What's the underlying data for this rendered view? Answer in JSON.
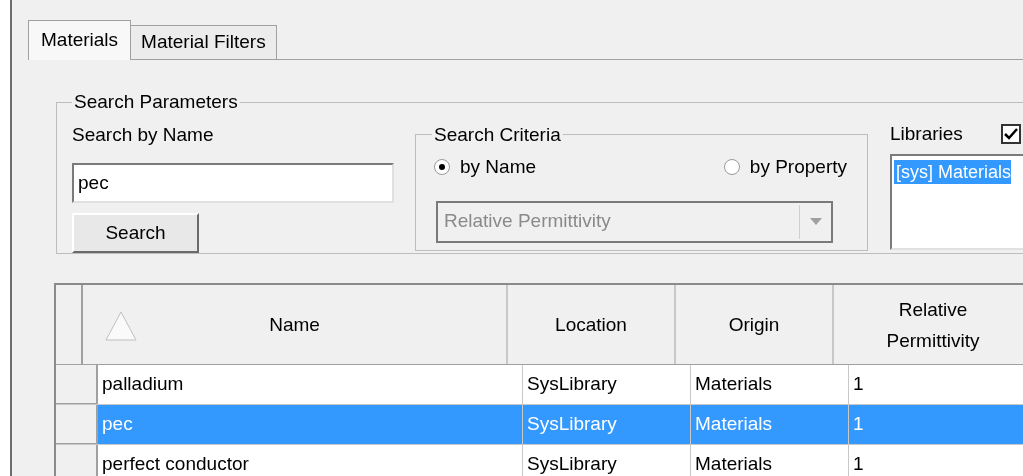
{
  "tabs": [
    {
      "label": "Materials",
      "selected": true
    },
    {
      "label": "Material Filters",
      "selected": false
    }
  ],
  "search_parameters": {
    "title": "Search Parameters",
    "search_by_name": {
      "label": "Search by Name",
      "value": "pec"
    },
    "search_button": "Search",
    "search_criteria": {
      "title": "Search Criteria",
      "options": [
        {
          "label": "by Name",
          "selected": true
        },
        {
          "label": "by Property",
          "selected": false
        }
      ],
      "property_dropdown": {
        "value": "Relative Permittivity",
        "disabled": true
      }
    },
    "libraries": {
      "label": "Libraries",
      "checked": true,
      "items": [
        {
          "label": "[sys] Materials",
          "selected": true
        }
      ]
    }
  },
  "table": {
    "columns": [
      "Name",
      "Location",
      "Origin",
      "Relative Permittivity"
    ],
    "rows": [
      {
        "cells": [
          "palladium",
          "SysLibrary",
          "Materials",
          "1"
        ],
        "selected": false
      },
      {
        "cells": [
          "pec",
          "SysLibrary",
          "Materials",
          "1"
        ],
        "selected": true
      },
      {
        "cells": [
          "perfect conductor",
          "SysLibrary",
          "Materials",
          "1"
        ],
        "selected": false
      }
    ]
  }
}
